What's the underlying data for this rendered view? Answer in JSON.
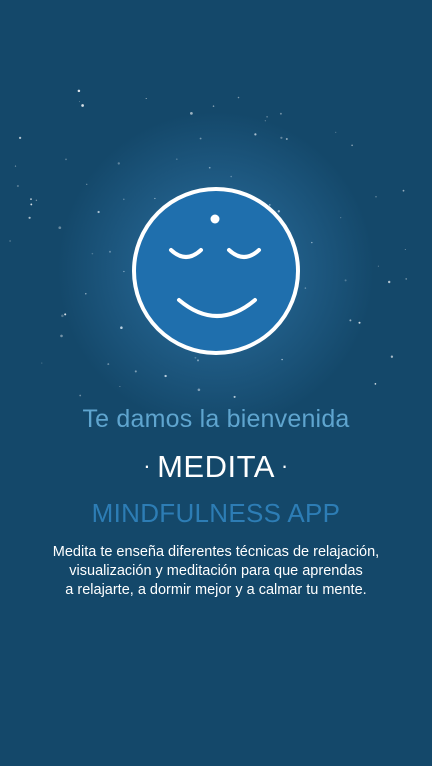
{
  "onboarding": {
    "welcome_text": "Te damos la bienvenida",
    "brand_dot": "·",
    "app_name": "MEDITA",
    "app_subtitle": "MINDFULNESS APP",
    "description_lines": [
      "Medita te enseña diferentes técnicas de relajación,",
      "visualización y meditación para que aprendas",
      "a relajarte, a dormir mejor y a calmar tu mente."
    ]
  },
  "logo": {
    "icon": "smiling-face-icon",
    "face_color": "#1f6fad",
    "outline_color": "#ffffff"
  },
  "colors": {
    "background": "#14486a",
    "welcome": "#5fa5cf",
    "subtitle": "#2d7db5",
    "text": "#ffffff"
  }
}
